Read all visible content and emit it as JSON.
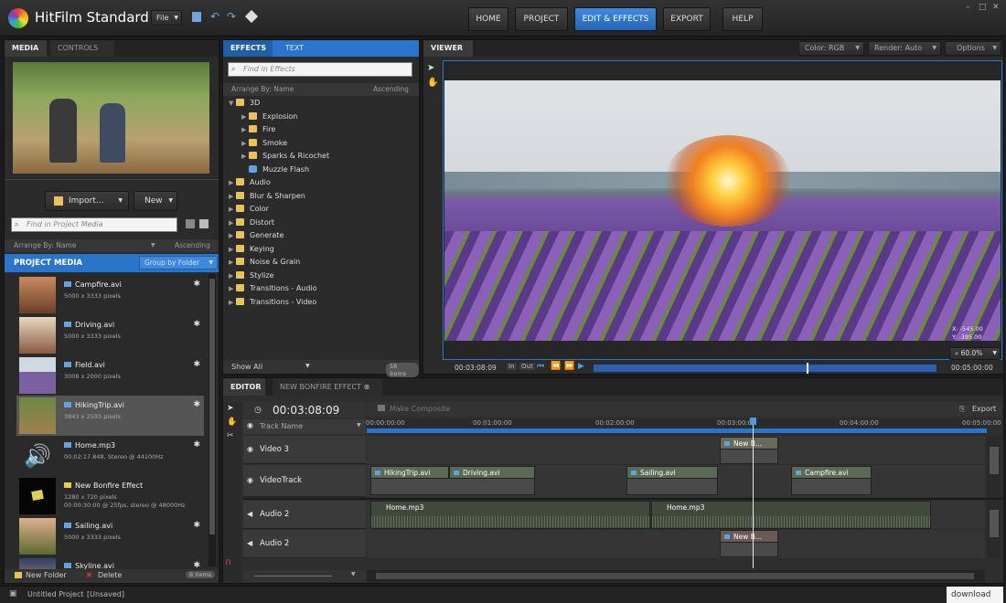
{
  "app": {
    "name": "HitFilm Standard",
    "file_menu": "File"
  },
  "top_nav": [
    "HOME",
    "PROJECT",
    "EDIT & EFFECTS",
    "EXPORT",
    "HELP"
  ],
  "top_nav_active": "EDIT & EFFECTS",
  "accent": "#2a75cc",
  "media_panel": {
    "tabs": [
      "MEDIA",
      "CONTROLS"
    ],
    "import_label": "Import...",
    "new_label": "New",
    "search_placeholder": "Find in Project Media",
    "arrange_by": "Arrange By: Name",
    "sort": "Ascending",
    "section_title": "PROJECT MEDIA",
    "group_by": "Group by Folder",
    "items": [
      {
        "name": "Campfire.avi",
        "details": "5000 x 3333 pixels"
      },
      {
        "name": "Driving.avi",
        "details": "5000 x 3333 pixels"
      },
      {
        "name": "Field.avi",
        "details": "3008 x 2000 pixels"
      },
      {
        "name": "HikingTrip.avi",
        "details": "3843 x 2593 pixels"
      },
      {
        "name": "Home.mp3",
        "details": "00:02:17.848, Stereo @ 44100Hz"
      },
      {
        "name": "New Bonfire Effect",
        "details": "1280 x 720 pixels",
        "details2": "00:00:30:00 @ 25fps, stereo @ 48000Hz"
      },
      {
        "name": "Sailing.avi",
        "details": "5000 x 3333 pixels"
      },
      {
        "name": "Skyline.avi",
        "details": ""
      }
    ],
    "new_folder": "New Folder",
    "delete": "Delete",
    "item_count": "8 items"
  },
  "effects_panel": {
    "tabs": [
      "EFFECTS",
      "TEXT"
    ],
    "search_placeholder": "Find in Effects",
    "arrange_by": "Arrange By: Name",
    "sort": "Ascending",
    "tree": [
      {
        "label": "3D",
        "level": 0,
        "expanded": true,
        "type": "folder"
      },
      {
        "label": "Explosion",
        "level": 1,
        "type": "folder"
      },
      {
        "label": "Fire",
        "level": 1,
        "type": "folder"
      },
      {
        "label": "Smoke",
        "level": 1,
        "type": "folder"
      },
      {
        "label": "Sparks & Ricochet",
        "level": 1,
        "type": "folder"
      },
      {
        "label": "Muzzle Flash",
        "level": 1,
        "type": "effect"
      },
      {
        "label": "Audio",
        "level": 0,
        "type": "folder"
      },
      {
        "label": "Blur & Sharpen",
        "level": 0,
        "type": "folder"
      },
      {
        "label": "Color",
        "level": 0,
        "type": "folder"
      },
      {
        "label": "Distort",
        "level": 0,
        "type": "folder"
      },
      {
        "label": "Generate",
        "level": 0,
        "type": "folder"
      },
      {
        "label": "Keying",
        "level": 0,
        "type": "folder"
      },
      {
        "label": "Noise & Grain",
        "level": 0,
        "type": "folder"
      },
      {
        "label": "Stylize",
        "level": 0,
        "type": "folder"
      },
      {
        "label": "Transitions - Audio",
        "level": 0,
        "type": "folder"
      },
      {
        "label": "Transitions - Video",
        "level": 0,
        "type": "folder"
      }
    ],
    "show": "Show All",
    "count": "58 items"
  },
  "viewer": {
    "title": "VIEWER",
    "color": "Color: RGB",
    "render": "Render: Auto",
    "options": "Options",
    "x_readout": "X: -545.00",
    "y_readout": "Y: -395.00",
    "zoom": "60.0%",
    "current_time": "00:03:08:09",
    "in": "In",
    "out": "Out",
    "end_time": "00:05:00:00",
    "playhead": 0.62
  },
  "editor": {
    "tabs": [
      "EDITOR",
      "NEW BONFIRE EFFECT"
    ],
    "timecode": "00:03:08:09",
    "make_composite": "Make Composite",
    "export": "Export",
    "track_name": "Track Name",
    "ruler": [
      "00:00:00:00",
      "00:01:00:00",
      "00:02:00:00",
      "00:03:00:00",
      "00:04:00:00",
      "00:05:00:00"
    ],
    "tracks": [
      "Video 3",
      "VideoTrack",
      "Audio 2",
      "Audio 2"
    ],
    "clips": {
      "video3": [
        "New B..."
      ],
      "videotrack": [
        "HikingTrip.avi",
        "Driving.avi",
        "Sailing.avi",
        "Campfire.avi"
      ],
      "audio1": [
        "Home.mp3",
        "Home.mp3"
      ],
      "audio2": [
        "New B..."
      ]
    }
  },
  "status": {
    "project": "Untitled Project",
    "state": "[Unsaved]",
    "watermark": "download"
  }
}
